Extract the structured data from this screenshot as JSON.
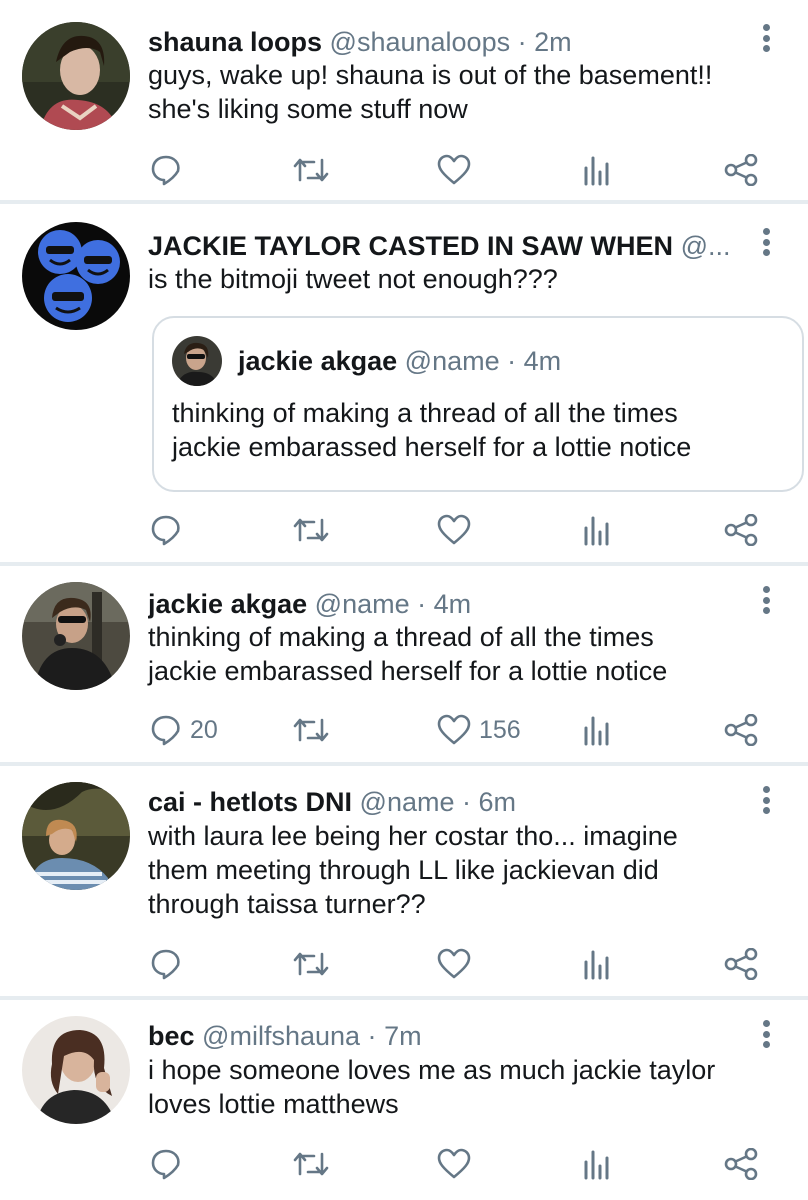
{
  "tweets": [
    {
      "name": "shauna loops",
      "handle": "@shaunaloops",
      "dot": "·",
      "time": "2m",
      "lines": [
        "guys, wake up! shauna is out of the basement!!",
        "she's liking some stuff now"
      ],
      "reply_count": "",
      "like_count": ""
    },
    {
      "name": "JACKIE TAYLOR CASTED IN SAW WHEN",
      "handle": "@...",
      "dot": "",
      "time": "",
      "lines": [
        "is the bitmoji tweet not enough???"
      ],
      "reply_count": "",
      "like_count": "",
      "quote": {
        "name": "jackie akgae",
        "handle": "@name",
        "dot": "·",
        "time": "4m",
        "lines": [
          "thinking of making a thread of all the times",
          "jackie embarassed herself for a lottie notice"
        ]
      }
    },
    {
      "name": "jackie akgae",
      "handle": "@name",
      "dot": "·",
      "time": "4m",
      "lines": [
        "thinking of making a thread of all the times",
        "jackie embarassed herself for a lottie notice"
      ],
      "reply_count": "20",
      "like_count": "156"
    },
    {
      "name": "cai - hetlots DNI",
      "handle": "@name",
      "dot": "·",
      "time": "6m",
      "lines": [
        "with laura lee being her costar tho... imagine",
        "them meeting through LL like jackievan did",
        "through taissa turner??"
      ],
      "reply_count": "",
      "like_count": ""
    },
    {
      "name": "bec",
      "handle": "@milfshauna",
      "dot": "·",
      "time": "7m",
      "lines": [
        "i hope someone loves me as much jackie taylor",
        "loves lottie matthews"
      ],
      "reply_count": "",
      "like_count": ""
    }
  ],
  "icons": {
    "reply": "reply-icon",
    "retweet": "retweet-icon",
    "like": "heart-icon",
    "analytics": "analytics-icon",
    "share": "share-icon",
    "menu": "more-options-icon"
  },
  "colors": {
    "text": "#14171a",
    "secondary": "#657786",
    "separator": "#e6ecf0",
    "border": "#d6dde3"
  }
}
